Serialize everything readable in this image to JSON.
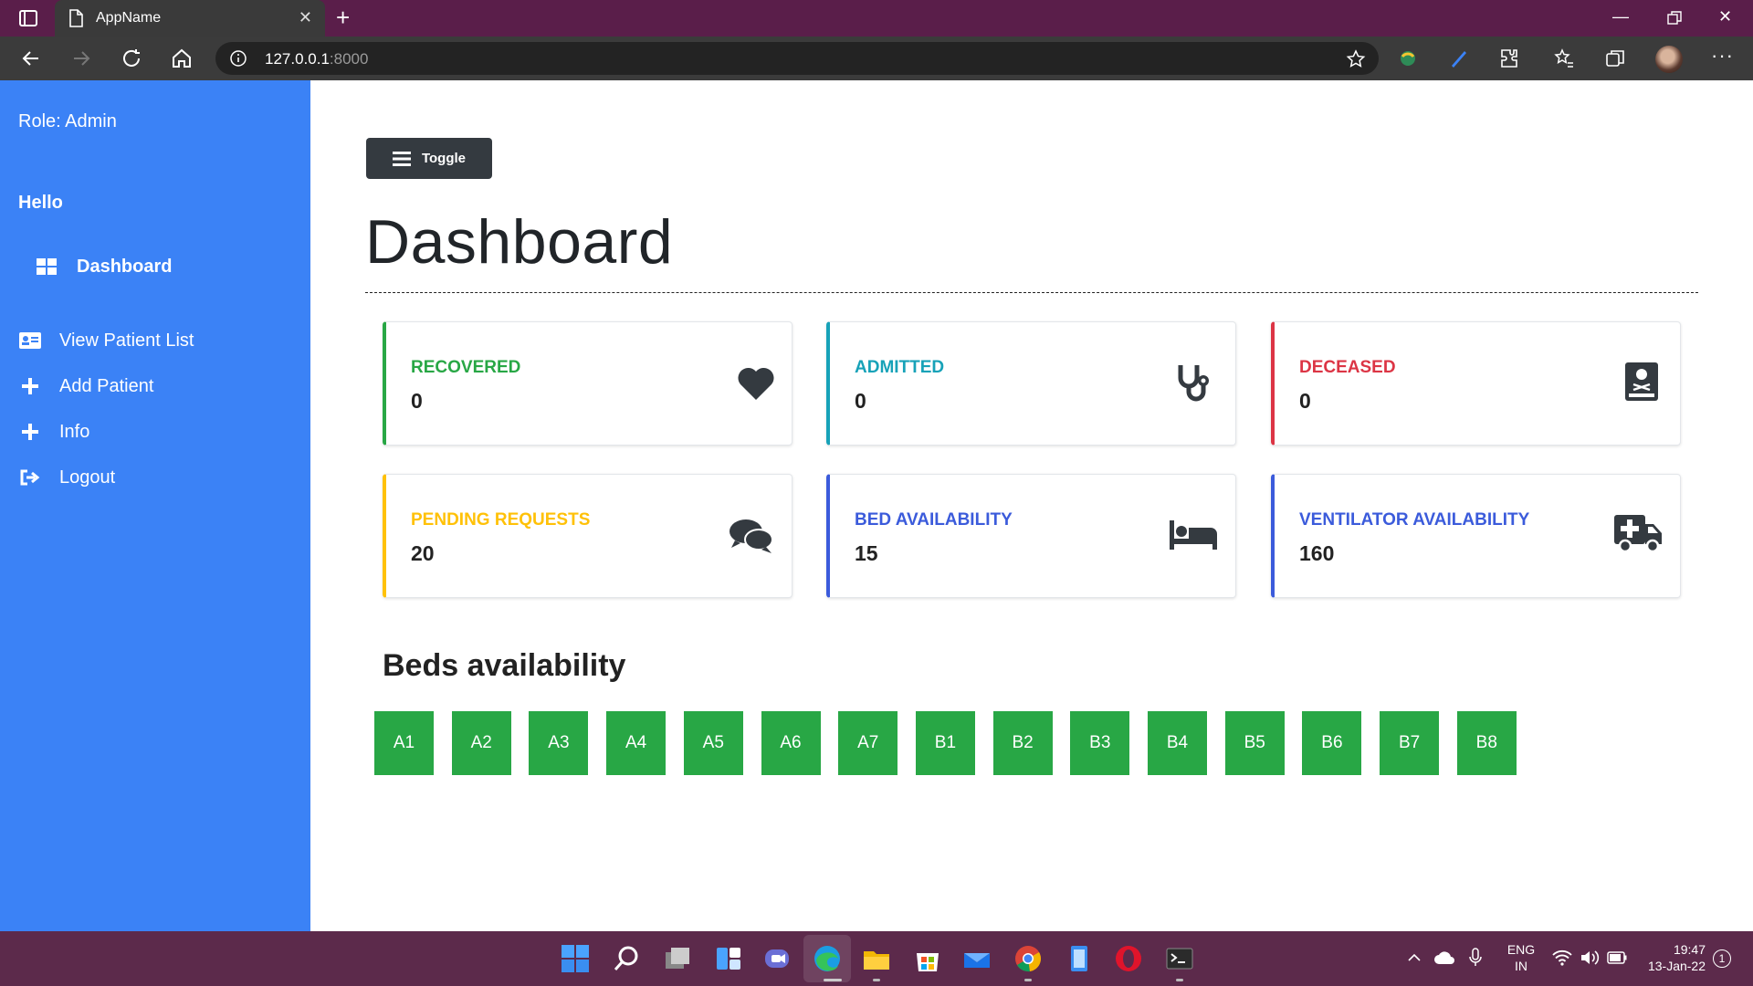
{
  "browser": {
    "tab_title": "AppName",
    "url_host": "127.0.0.1",
    "url_port": ":8000"
  },
  "sidebar": {
    "role": "Role: Admin",
    "greeting": "Hello",
    "items": [
      {
        "label": "Dashboard",
        "icon": "dashboard-grid-icon"
      },
      {
        "label": "View Patient List",
        "icon": "id-card-icon"
      },
      {
        "label": "Add Patient",
        "icon": "plus-icon"
      },
      {
        "label": "Info",
        "icon": "plus-icon"
      },
      {
        "label": "Logout",
        "icon": "logout-icon"
      }
    ]
  },
  "main": {
    "toggle_label": "Toggle",
    "title": "Dashboard",
    "cards": [
      {
        "label": "RECOVERED",
        "value": "0",
        "color": "#28a745",
        "icon": "heart-icon"
      },
      {
        "label": "ADMITTED",
        "value": "0",
        "color": "#17a2b8",
        "icon": "stethoscope-icon"
      },
      {
        "label": "DECEASED",
        "value": "0",
        "color": "#dc3545",
        "icon": "book-dead-icon"
      },
      {
        "label": "PENDING REQUESTS",
        "value": "20",
        "color": "#ffc107",
        "icon": "comments-icon"
      },
      {
        "label": "BED AVAILABILITY",
        "value": "15",
        "color": "#3b5bdb",
        "icon": "bed-icon"
      },
      {
        "label": "VENTILATOR AVAILABILITY",
        "value": "160",
        "color": "#3b5bdb",
        "icon": "ambulance-icon"
      }
    ],
    "beds_title": "Beds availability",
    "beds": [
      "A1",
      "A2",
      "A3",
      "A4",
      "A5",
      "A6",
      "A7",
      "B1",
      "B2",
      "B3",
      "B4",
      "B5",
      "B6",
      "B7",
      "B8"
    ],
    "bed_color": "#28a745"
  },
  "taskbar": {
    "lang_line1": "ENG",
    "lang_line2": "IN",
    "time": "19:47",
    "date": "13-Jan-22",
    "notification_count": "1"
  }
}
